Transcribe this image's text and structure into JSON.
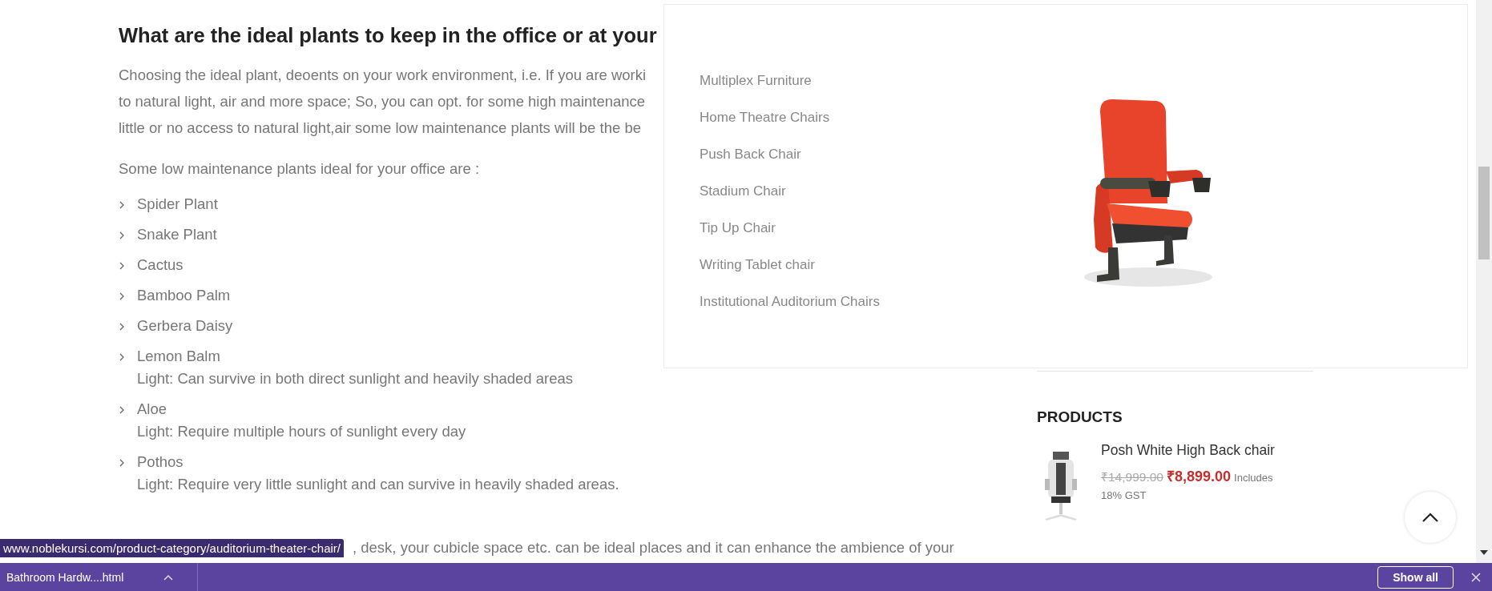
{
  "article": {
    "heading": "What are the ideal plants to keep in the office or at your",
    "lines": [
      "Choosing the ideal plant, deoents on your work environment, i.e. If you are worki",
      "to natural light, air and more space; So, you can opt. for some high maintenance",
      "little or no access to natural light,air some low maintenance plants will be the be"
    ],
    "intro": "Some low maintenance plants ideal for your office are :",
    "plants": [
      {
        "name": "Spider Plant"
      },
      {
        "name": "Snake Plant"
      },
      {
        "name": "Cactus"
      },
      {
        "name": "Bamboo Palm"
      },
      {
        "name": "Gerbera Daisy"
      },
      {
        "name": "Lemon Balm",
        "note": "Light: Can survive in both direct sunlight and heavily shaded areas"
      },
      {
        "name": "Aloe",
        "note": "Light: Require multiple hours of sunlight every day"
      },
      {
        "name": "Pothos",
        "note": "Light: Require very little sunlight and can survive in heavily shaded areas."
      }
    ],
    "closing": ", desk, your cubicle space etc. can be ideal places and it can enhance the ambience of your"
  },
  "mega_menu": {
    "items": [
      "Multiplex Furniture",
      "Home Theatre Chairs",
      "Push Back Chair",
      "Stadium Chair",
      "Tip Up Chair",
      "Writing Tablet chair",
      "Institutional Auditorium Chairs"
    ]
  },
  "sidebar": {
    "title": "PRODUCTS",
    "products": [
      {
        "name": "Posh White High Back chair",
        "old_price": "₹14,999.00",
        "price": "₹8,899.00",
        "tax_note": [
          "Includes",
          "18% GST"
        ]
      }
    ]
  },
  "status_url": "www.noblekursi.com/product-category/auditorium-theater-chair/",
  "downloads_bar": {
    "file": "Bathroom Hardw....html",
    "button": "Show all"
  }
}
